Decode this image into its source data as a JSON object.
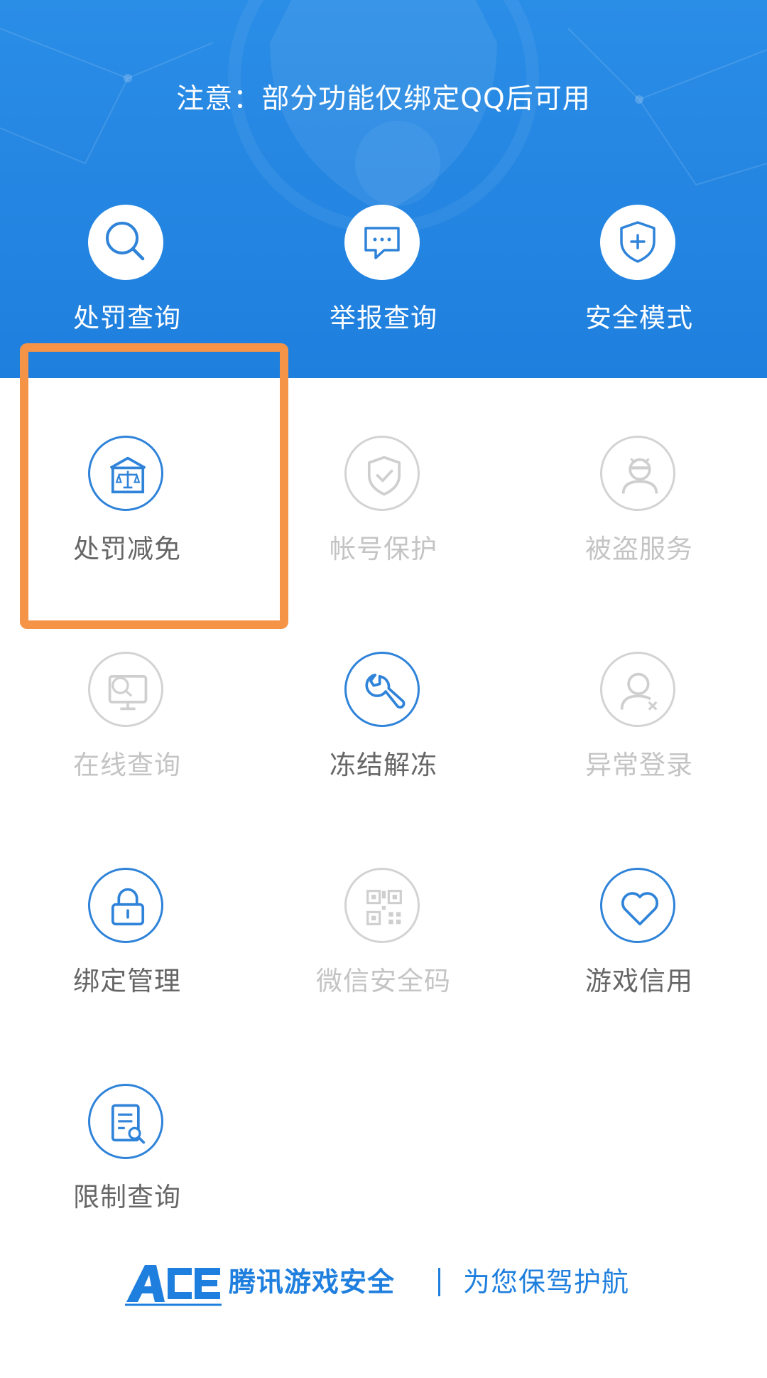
{
  "banner": {
    "notice": "注意：部分功能仅绑定QQ后可用",
    "items": [
      {
        "label": "处罚查询",
        "icon": "search-icon"
      },
      {
        "label": "举报查询",
        "icon": "chat-bubble-icon"
      },
      {
        "label": "安全模式",
        "icon": "shield-plus-icon"
      }
    ]
  },
  "grid": {
    "items": [
      {
        "label": "处罚减免",
        "icon": "scales-building-icon",
        "enabled": true
      },
      {
        "label": "帐号保护",
        "icon": "shield-check-icon",
        "enabled": false
      },
      {
        "label": "被盗服务",
        "icon": "thief-icon",
        "enabled": false
      },
      {
        "label": "在线查询",
        "icon": "monitor-search-icon",
        "enabled": false
      },
      {
        "label": "冻结解冻",
        "icon": "wrench-icon",
        "enabled": true
      },
      {
        "label": "异常登录",
        "icon": "user-x-icon",
        "enabled": false
      },
      {
        "label": "绑定管理",
        "icon": "lock-icon",
        "enabled": true
      },
      {
        "label": "微信安全码",
        "icon": "qr-code-icon",
        "enabled": false
      },
      {
        "label": "游戏信用",
        "icon": "heart-icon",
        "enabled": true
      },
      {
        "label": "限制查询",
        "icon": "document-search-icon",
        "enabled": true
      }
    ]
  },
  "footer": {
    "brand": "腾讯游戏安全",
    "slogan": "为您保驾护航",
    "logo_icon": "ace-logo-icon"
  },
  "colors": {
    "primary": "#1f7fde",
    "banner": "#2a8de6",
    "highlight": "#f59447",
    "disabled": "#c4c4c4",
    "label": "#666666"
  }
}
